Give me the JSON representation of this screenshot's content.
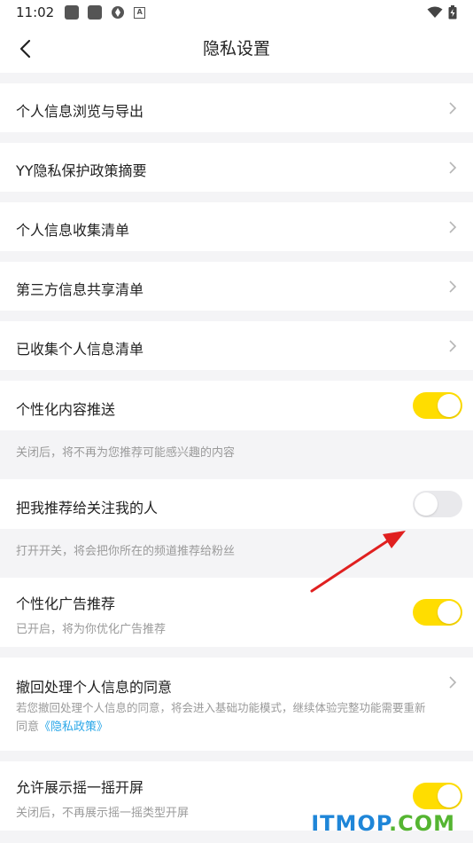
{
  "statusbar": {
    "time": "11:02",
    "a_glyph": "A"
  },
  "header": {
    "title": "隐私设置"
  },
  "menu": [
    {
      "label": "个人信息浏览与导出"
    },
    {
      "label": "YY隐私保护政策摘要"
    },
    {
      "label": "个人信息收集清单"
    },
    {
      "label": "第三方信息共享清单"
    },
    {
      "label": "已收集个人信息清单"
    }
  ],
  "personalized_content": {
    "label": "个性化内容推送",
    "enabled": true,
    "note": "关闭后，将不再为您推荐可能感兴趣的内容"
  },
  "recommend_to_followers": {
    "label": "把我推荐给关注我的人",
    "enabled": false,
    "note": "打开开关，将会把你所在的频道推荐给粉丝"
  },
  "personalized_ads": {
    "label": "个性化广告推荐",
    "desc": "已开启，将为你优化广告推荐",
    "enabled": true
  },
  "withdraw_consent": {
    "label": "撤回处理个人信息的同意",
    "desc_line1": "若您撤回处理个人信息的同意，将会进入基础功能模式，继续体验完整功能需要重新",
    "desc_prefix": "同意",
    "link": "《隐私政策》"
  },
  "shake_screen": {
    "label": "允许展示摇一摇开屏",
    "desc": "关闭后，不再展示摇一摇类型开屏",
    "enabled": true
  },
  "watermark": {
    "part1": "ITMOP",
    "part2": ".COM"
  },
  "colors": {
    "toggle_on": "#ffdd00",
    "toggle_off": "#e9e9ec",
    "link": "#2aa7e8",
    "arrow": "#e02020"
  }
}
